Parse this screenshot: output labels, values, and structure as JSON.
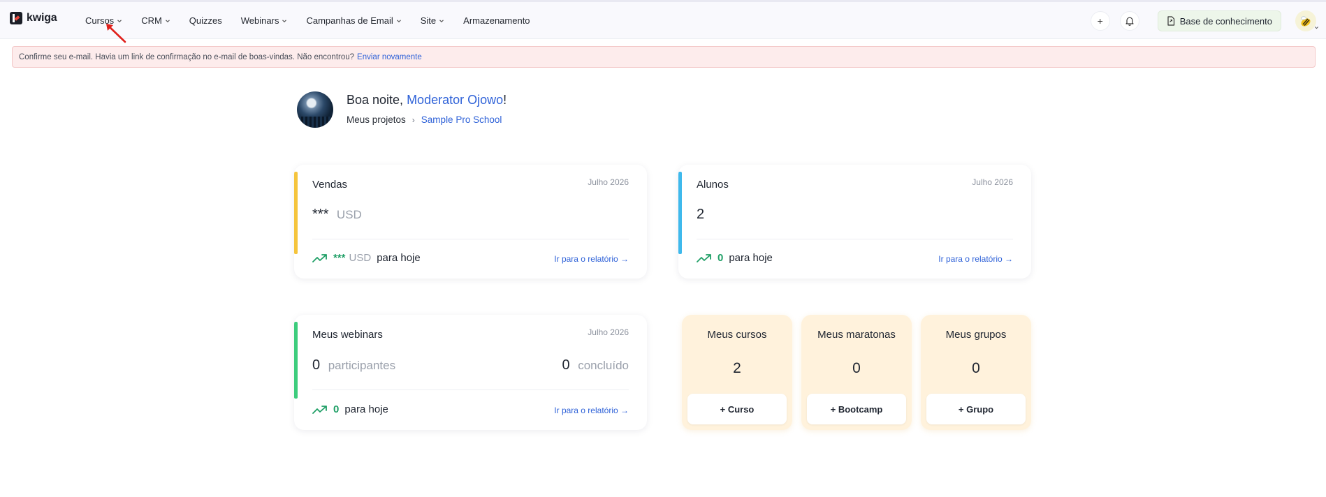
{
  "brand": {
    "name": "kwiga"
  },
  "nav": {
    "items": [
      {
        "label": "Cursos",
        "has_dropdown": true
      },
      {
        "label": "CRM",
        "has_dropdown": true
      },
      {
        "label": "Quizzes",
        "has_dropdown": false
      },
      {
        "label": "Webinars",
        "has_dropdown": true
      },
      {
        "label": "Campanhas de Email",
        "has_dropdown": true
      },
      {
        "label": "Site",
        "has_dropdown": true
      },
      {
        "label": "Armazenamento",
        "has_dropdown": false
      }
    ],
    "add_label": "+",
    "knowledge_base_label": "Base de conhecimento"
  },
  "alert": {
    "message": "Confirme seu e-mail. Havia um link de confirmação no e-mail de boas-vindas. Não encontrou?",
    "link": "Enviar novamente"
  },
  "greeting": {
    "prefix": "Boa noite, ",
    "name": "Moderator Ojowo",
    "suffix": "!",
    "crumb_root": "Meus projetos",
    "crumb_project": "Sample Pro School"
  },
  "sales": {
    "title": "Vendas",
    "date": "Julho 2026",
    "amount": "***",
    "currency": "USD",
    "today_amount": "***",
    "today_currency": "USD",
    "today_label": "para hoje",
    "report_link": "Ir para o relatório →",
    "accent": "#f5c43c"
  },
  "students": {
    "title": "Alunos",
    "date": "Julho 2026",
    "count": "2",
    "today_count": "0",
    "today_label": "para hoje",
    "report_link": "Ir para o relatório →",
    "accent": "#3fb9ec"
  },
  "webinars": {
    "title": "Meus webinars",
    "date": "Julho 2026",
    "participants": "0",
    "participants_label": "participantes",
    "completed": "0",
    "completed_label": "concluído",
    "today_count": "0",
    "today_label": "para hoje",
    "report_link": "Ir para o relatório →",
    "accent": "#3ccc7c"
  },
  "tiles": [
    {
      "title": "Meus cursos",
      "count": "2",
      "button": "+ Curso"
    },
    {
      "title": "Meus maratonas",
      "count": "0",
      "button": "+ Bootcamp"
    },
    {
      "title": "Meus grupos",
      "count": "0",
      "button": "+ Grupo"
    }
  ]
}
